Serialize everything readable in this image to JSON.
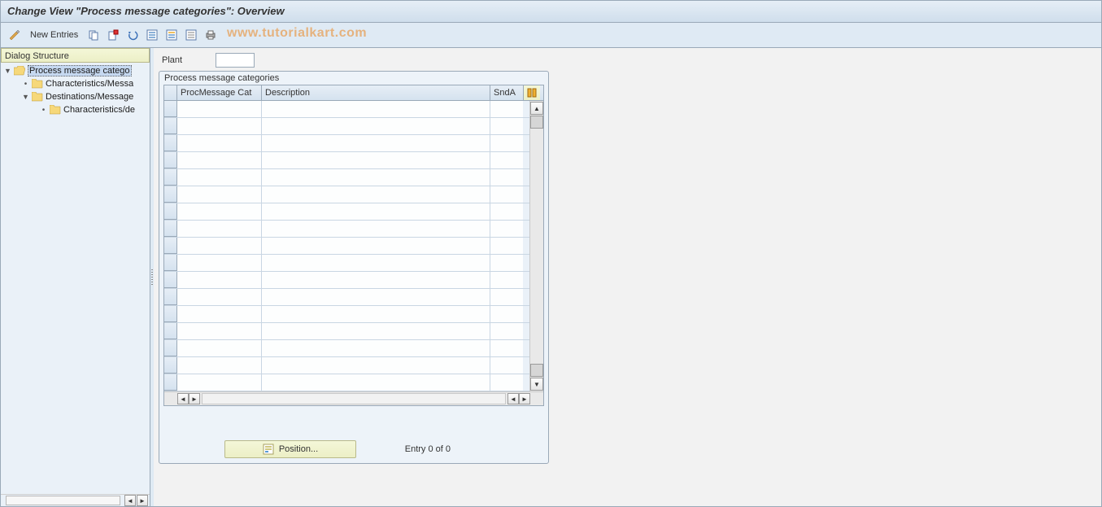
{
  "title": "Change View \"Process message categories\": Overview",
  "toolbar": {
    "new_entries": "New Entries"
  },
  "watermark": "www.tutorialkart.com",
  "sidebar": {
    "header": "Dialog Structure",
    "nodes": {
      "n0": "Process message catego",
      "n1": "Characteristics/Messa",
      "n2": "Destinations/Message",
      "n3": "Characteristics/de"
    }
  },
  "content": {
    "plant_label": "Plant",
    "plant_value": "",
    "group_title": "Process message categories",
    "columns": {
      "c1": "ProcMessage Cat",
      "c2": "Description",
      "c3": "SndA"
    },
    "position_btn": "Position...",
    "entry_text": "Entry 0 of 0"
  }
}
